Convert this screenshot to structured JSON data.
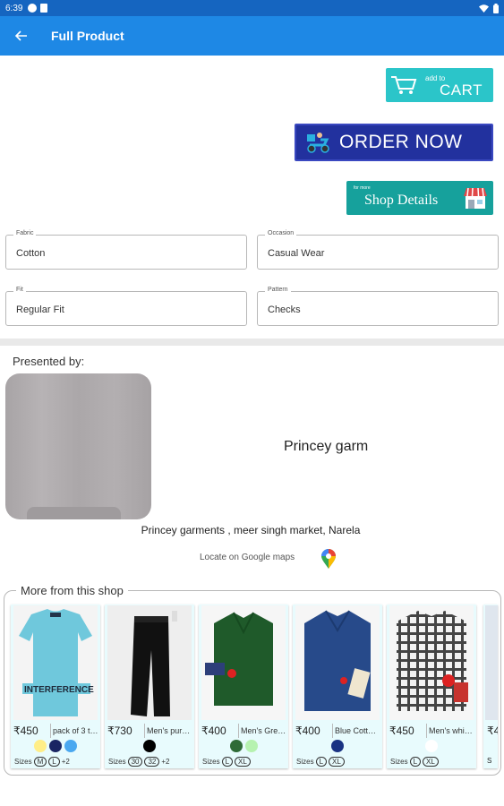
{
  "status_bar": {
    "time": "6:39"
  },
  "app_bar": {
    "title": "Full Product"
  },
  "actions": {
    "cart_small": "add to",
    "cart_label": "CART",
    "order_label": "ORDER NOW",
    "shop_small": "for more",
    "shop_label": "Shop Details"
  },
  "attributes": [
    {
      "label": "Fabric",
      "value": "Cotton"
    },
    {
      "label": "Occasion",
      "value": "Casual Wear"
    },
    {
      "label": "Fit",
      "value": "Regular Fit"
    },
    {
      "label": "Pattern",
      "value": "Checks"
    }
  ],
  "seller": {
    "presented_label": "Presented by:",
    "name": "Princey garm",
    "address": "Princey garments , meer singh market, Narela",
    "locate_text": "Locate on Google maps"
  },
  "more_from_shop": {
    "title": "More from this shop",
    "sizes_label": "Sizes",
    "products": [
      {
        "price": "₹450",
        "name": "pack of 3 th...",
        "colors": [
          "#ffee88",
          "#1a2563",
          "#4aa8f0"
        ],
        "sizes": [
          "M",
          "L"
        ],
        "more": "+2"
      },
      {
        "price": "₹730",
        "name": "Men's pure ...",
        "colors": [
          "#000000"
        ],
        "sizes": [
          "30",
          "32"
        ],
        "more": "+2"
      },
      {
        "price": "₹400",
        "name": "Men's Gree...",
        "colors": [
          "#2f6b36",
          "#b6f2b0"
        ],
        "sizes": [
          "L",
          "XL"
        ],
        "more": ""
      },
      {
        "price": "₹400",
        "name": "Blue Cotton...",
        "colors": [
          "#1a3383"
        ],
        "sizes": [
          "L",
          "XL"
        ],
        "more": ""
      },
      {
        "price": "₹450",
        "name": "Men's white...",
        "colors": [
          "#ffffff"
        ],
        "sizes": [
          "L",
          "XL"
        ],
        "more": ""
      }
    ],
    "peek": {
      "price": "₹4",
      "sizes_label": "S"
    }
  }
}
